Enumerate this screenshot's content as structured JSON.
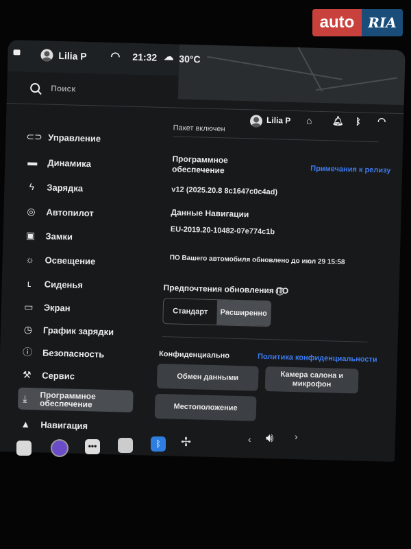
{
  "watermark": {
    "auto": "auto",
    "ria": "RIA"
  },
  "status": {
    "user": "Lilia P",
    "time": "21:32",
    "temp": "30°C"
  },
  "search": {
    "placeholder": "Поиск"
  },
  "header": {
    "user": "Lilia P"
  },
  "sidebar": {
    "items": [
      {
        "label": "Управление",
        "icon": "toggle-icon"
      },
      {
        "label": "Динамика",
        "icon": "car-icon"
      },
      {
        "label": "Зарядка",
        "icon": "bolt-icon"
      },
      {
        "label": "Автопилот",
        "icon": "steering-wheel-icon"
      },
      {
        "label": "Замки",
        "icon": "lock-icon"
      },
      {
        "label": "Освещение",
        "icon": "sun-icon"
      },
      {
        "label": "Сиденья",
        "icon": "seat-icon"
      },
      {
        "label": "Экран",
        "icon": "display-icon"
      },
      {
        "label": "График зарядки",
        "icon": "alarm-clock-icon"
      },
      {
        "label": "Безопасность",
        "icon": "shield-icon"
      },
      {
        "label": "Сервис",
        "icon": "wrench-icon"
      },
      {
        "label": "Программное\nобеспечение",
        "icon": "download-icon"
      },
      {
        "label": "Навигация",
        "icon": "navigation-icon"
      }
    ]
  },
  "main": {
    "package_status": "Пакет включен",
    "software_title": "Программное\nобеспечение",
    "release_notes_link": "Примечания к релизу",
    "version": "v12 (2025.20.8 8c1647c0c4ad)",
    "nav_data_title": "Данные Навигации",
    "nav_data_version": "EU-2019.20-10482-07e774c1b",
    "updated_text": "ПО Вашего автомобиля обновлено до июл 29 15:58",
    "update_pref_title": "Предпочтения обновления ПО",
    "update_options": [
      "Стандарт",
      "Расширенно"
    ],
    "update_selected": "Расширенно",
    "privacy_title": "Конфиденциально",
    "privacy_link": "Политика конфиденциальности",
    "privacy_buttons": [
      "Обмен данными",
      "Камера салона и\nмикрофон",
      "Местоположение"
    ]
  },
  "dock": {
    "icons": [
      "app-launcher-icon",
      "camera-icon",
      "more-icon",
      "info-icon",
      "bluetooth-icon",
      "fan-icon",
      "chevron-left-icon",
      "volume-icon",
      "chevron-right-icon"
    ]
  },
  "colors": {
    "accent_link": "#3c7bf0",
    "background": "#18191b",
    "active_item": "#4a4d52"
  }
}
